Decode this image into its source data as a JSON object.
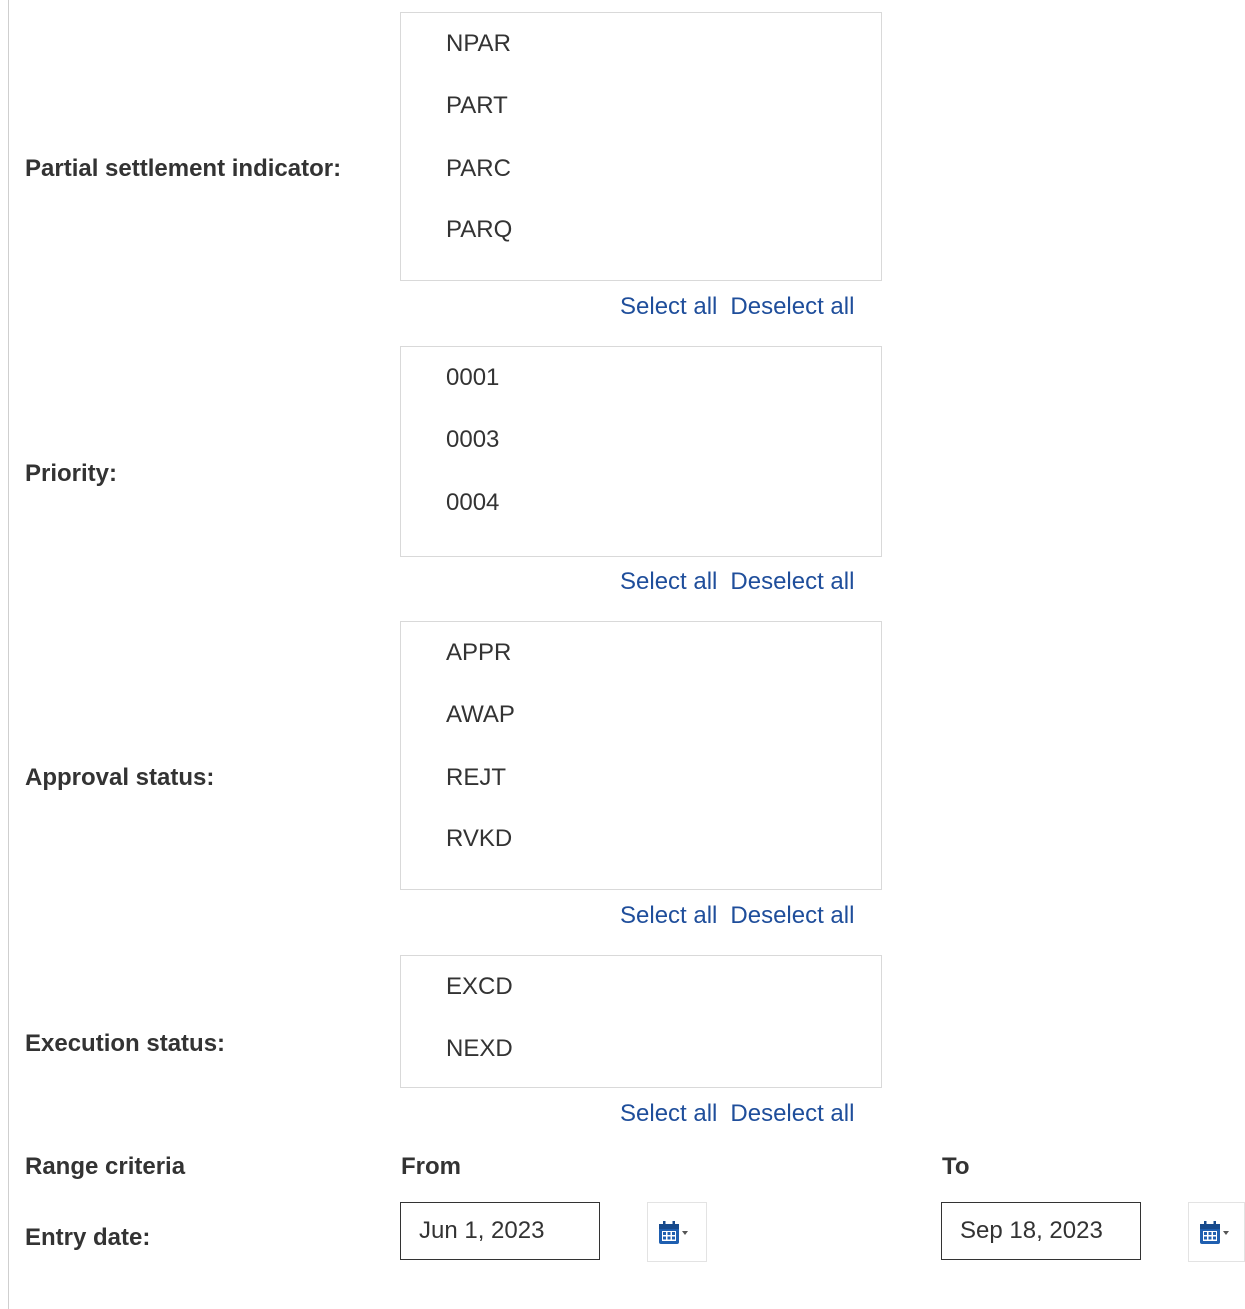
{
  "filters": [
    {
      "label": "Partial settlement indicator:",
      "options": [
        "NPAR",
        "PART",
        "PARC",
        "PARQ"
      ],
      "select_all": "Select all",
      "deselect_all": "Deselect all"
    },
    {
      "label": "Priority:",
      "options": [
        "0001",
        "0003",
        "0004"
      ],
      "select_all": "Select all",
      "deselect_all": "Deselect all"
    },
    {
      "label": "Approval status:",
      "options": [
        "APPR",
        "AWAP",
        "REJT",
        "RVKD"
      ],
      "select_all": "Select all",
      "deselect_all": "Deselect all"
    },
    {
      "label": "Execution status:",
      "options": [
        "EXCD",
        "NEXD"
      ],
      "select_all": "Select all",
      "deselect_all": "Deselect all"
    }
  ],
  "range": {
    "title": "Range criteria",
    "from_header": "From",
    "to_header": "To",
    "entry_date_label": "Entry date:",
    "from_value": "Jun 1, 2023",
    "to_value": "Sep 18, 2023"
  },
  "colors": {
    "link": "#1f4e9b",
    "calendar_icon": "#1f5fb0"
  },
  "icons": {
    "calendar": "calendar-icon",
    "dropdown": "dropdown-caret-icon"
  }
}
